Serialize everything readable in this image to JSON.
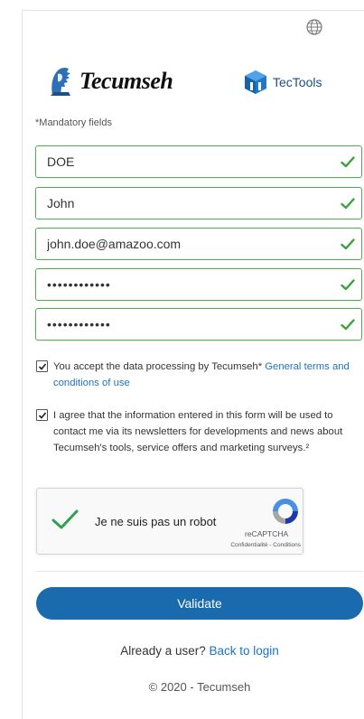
{
  "header": {
    "language_icon": "globe-icon",
    "tecumseh_logo_text": "Tecumseh",
    "tectools_logo_text": "TecTools"
  },
  "form": {
    "mandatory_note": "*Mandatory fields",
    "fields": [
      {
        "value": "DOE",
        "type": "text",
        "status": "valid"
      },
      {
        "value": "John",
        "type": "text",
        "status": "valid"
      },
      {
        "value": "john.doe@amazoo.com",
        "type": "email",
        "status": "valid"
      },
      {
        "value": "••••••••••••",
        "type": "password",
        "status": "valid"
      },
      {
        "value": "••••••••••••",
        "type": "password",
        "status": "valid"
      }
    ],
    "consent_data_processing": {
      "checked": true,
      "text": "You accept the data processing by Tecumseh* ",
      "link_text": "General terms and conditions of use"
    },
    "consent_newsletter": {
      "checked": true,
      "text": "I agree that the information entered in this form will be used to contact me via its newsletters for developments and news about Tecumseh's tools, service offers and marketing surveys.²"
    },
    "recaptcha": {
      "label": "Je ne suis pas un robot",
      "brand": "reCAPTCHA",
      "terms": "Confidentialité - Conditions",
      "checked": true
    },
    "validate_label": "Validate"
  },
  "footer": {
    "already_user_text": "Already a user? ",
    "back_to_login_text": "Back to login",
    "copyright": "© 2020 - Tecumseh"
  },
  "colors": {
    "valid_green": "#4cae4c",
    "primary_blue": "#1a6aae",
    "link_blue": "#1a73c9"
  }
}
